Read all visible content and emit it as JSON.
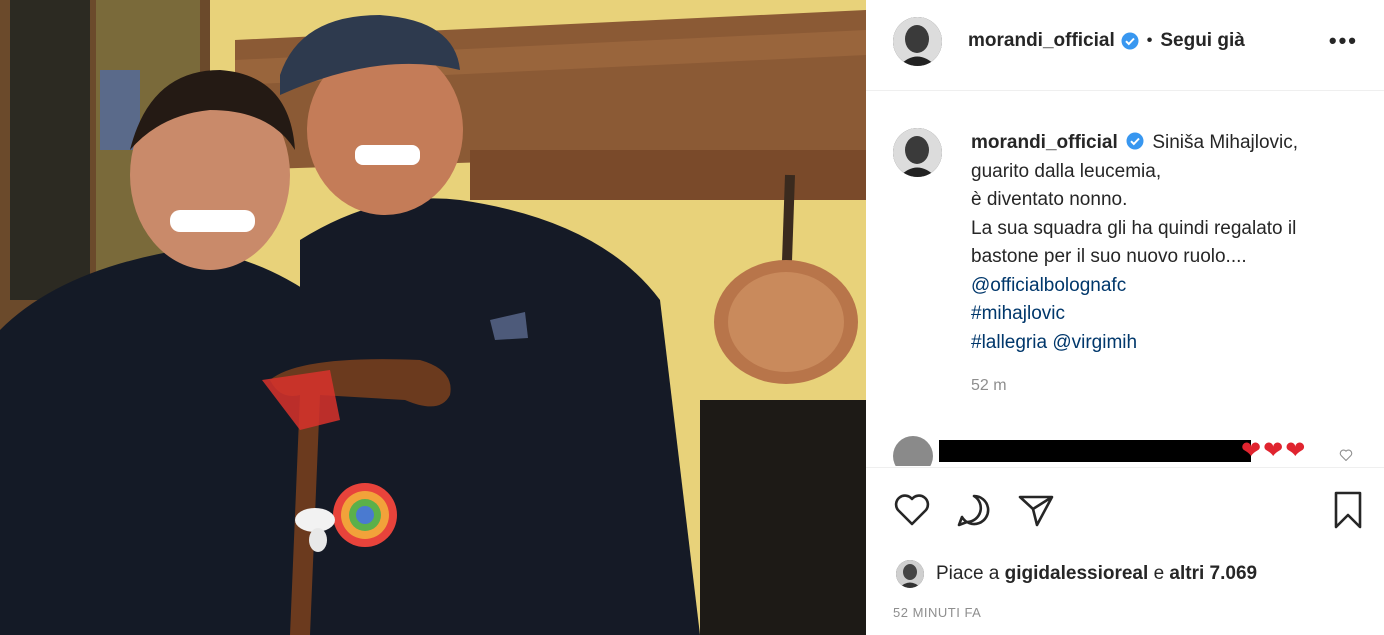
{
  "post": {
    "username": "morandi_official",
    "follow_label": "Segui già",
    "more_label": "•••"
  },
  "caption": {
    "username": "morandi_official",
    "lines": [
      "Siniša Mihajlovic,",
      "guarito dalla leucemia,",
      "è diventato nonno.",
      "La sua squadra gli ha quindi regalato il",
      "bastone per il suo nuovo ruolo...."
    ],
    "links": [
      "@officialbolognafc",
      "#mihajlovic",
      "#lallegria @virgimih"
    ],
    "time": "52 m"
  },
  "comment": {
    "hearts": "❤❤❤"
  },
  "likes": {
    "prefix": "Piace a",
    "user": "gigidalessioreal",
    "middle": "e",
    "others": "altri 7.069"
  },
  "posted": "52 MINUTI FA",
  "icons": [
    "verified-badge-icon",
    "heart-icon",
    "comment-icon",
    "share-icon",
    "bookmark-icon",
    "more-options-icon"
  ],
  "colors": {
    "verified": "#3897f0",
    "link": "#00376b",
    "heart": "#e0242f",
    "muted": "#8e8e8e"
  }
}
